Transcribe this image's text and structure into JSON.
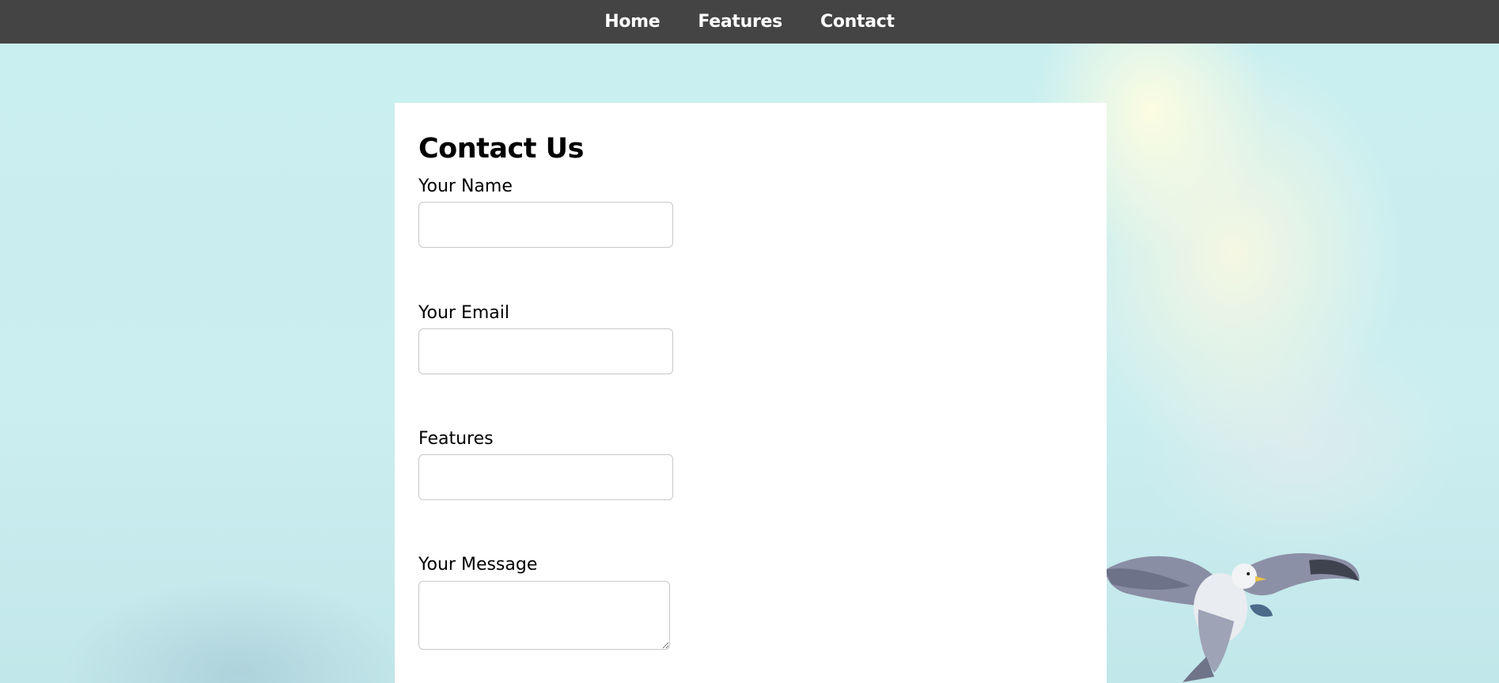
{
  "nav": {
    "items": [
      {
        "label": "Home"
      },
      {
        "label": "Features"
      },
      {
        "label": "Contact"
      }
    ]
  },
  "form": {
    "title": "Contact Us",
    "fields": [
      {
        "label": "Your Name",
        "value": "",
        "type": "text"
      },
      {
        "label": "Your Email",
        "value": "",
        "type": "email"
      },
      {
        "label": "Features",
        "value": "",
        "type": "text"
      },
      {
        "label": "Your Message",
        "value": "",
        "type": "textarea"
      }
    ]
  },
  "background": {
    "sky_color": "#cdeff0",
    "navbar_color": "#444444"
  }
}
